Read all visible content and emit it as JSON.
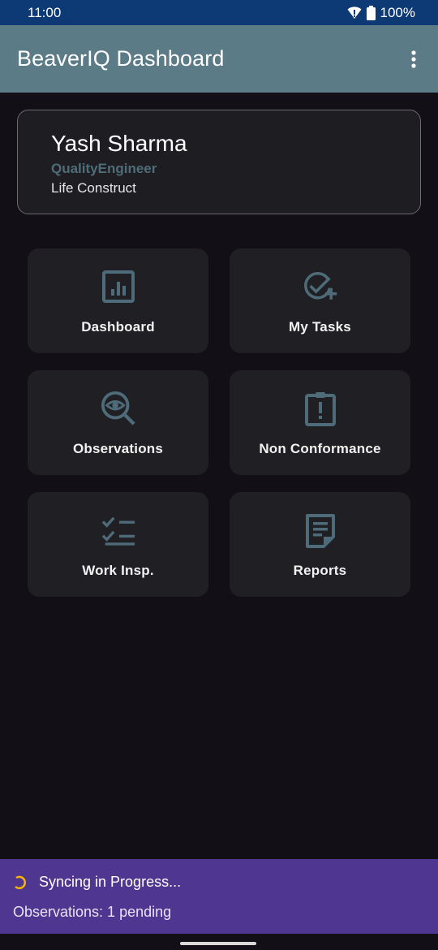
{
  "status_bar": {
    "time": "11:00",
    "battery": "100%"
  },
  "app_bar": {
    "title": "BeaverIQ Dashboard",
    "menu_icon": "more-vert-icon"
  },
  "profile": {
    "name": "Yash Sharma",
    "role": "QualityEngineer",
    "company": "Life Construct"
  },
  "tiles": [
    {
      "label": "Dashboard",
      "icon": "analytics-icon"
    },
    {
      "label": "My Tasks",
      "icon": "task-add-icon"
    },
    {
      "label": "Observations",
      "icon": "observe-icon"
    },
    {
      "label": "Non Conformance",
      "icon": "clipboard-alert-icon"
    },
    {
      "label": "Work Insp.",
      "icon": "checklist-icon"
    },
    {
      "label": "Reports",
      "icon": "report-icon"
    }
  ],
  "sync": {
    "title": "Syncing in Progress...",
    "detail": "Observations: 1 pending"
  },
  "colors": {
    "status_bar": "#0d3a74",
    "app_bar": "#5b7b87",
    "icon": "#4d6b78",
    "sync_bar": "#4f3690",
    "spinner": "#f5b400"
  }
}
